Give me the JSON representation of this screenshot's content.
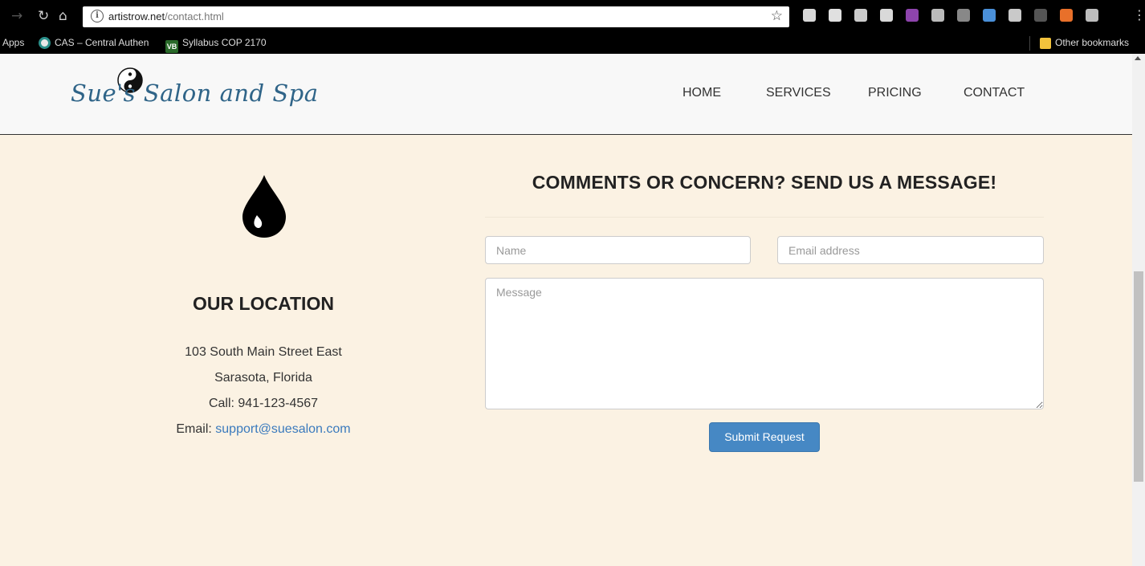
{
  "browser": {
    "url_host": "artistrow.net",
    "url_path": "/contact.html",
    "bookmarks": [
      {
        "label": "Apps"
      },
      {
        "label": "CAS – Central Authen"
      },
      {
        "label": "Syllabus COP 2170",
        "icon_text": "VB"
      },
      {
        "label": "Other bookmarks"
      }
    ],
    "extension_colors": [
      "#d8d8d8",
      "#e0e0e0",
      "#cccccc",
      "#d9d9d9",
      "#8e44ad",
      "#bbbbbb",
      "#888888",
      "#4a90d9",
      "#c9c9c9",
      "#555555",
      "#e8702a",
      "#bdbdbd"
    ]
  },
  "site": {
    "logo_text": "Sue's Salon and Spa",
    "nav": {
      "home": "HOME",
      "services": "SERVICES",
      "pricing": "PRICING",
      "contact": "CONTACT"
    }
  },
  "location": {
    "title": "OUR LOCATION",
    "street": "103 South Main Street East",
    "city": "Sarasota, Florida",
    "phone": "Call: 941-123-4567",
    "email_label": "Email: ",
    "email": "support@suesalon.com"
  },
  "contact_form": {
    "title": "COMMENTS OR CONCERN? SEND US A MESSAGE!",
    "name_placeholder": "Name",
    "email_placeholder": "Email address",
    "message_placeholder": "Message",
    "submit_label": "Submit Request"
  },
  "colors": {
    "page_bg": "#fbf2e3",
    "header_bg": "#f8f8f8",
    "logo_blue": "#2f6488",
    "button_blue": "#4688c4",
    "link_blue": "#3a7abd"
  }
}
